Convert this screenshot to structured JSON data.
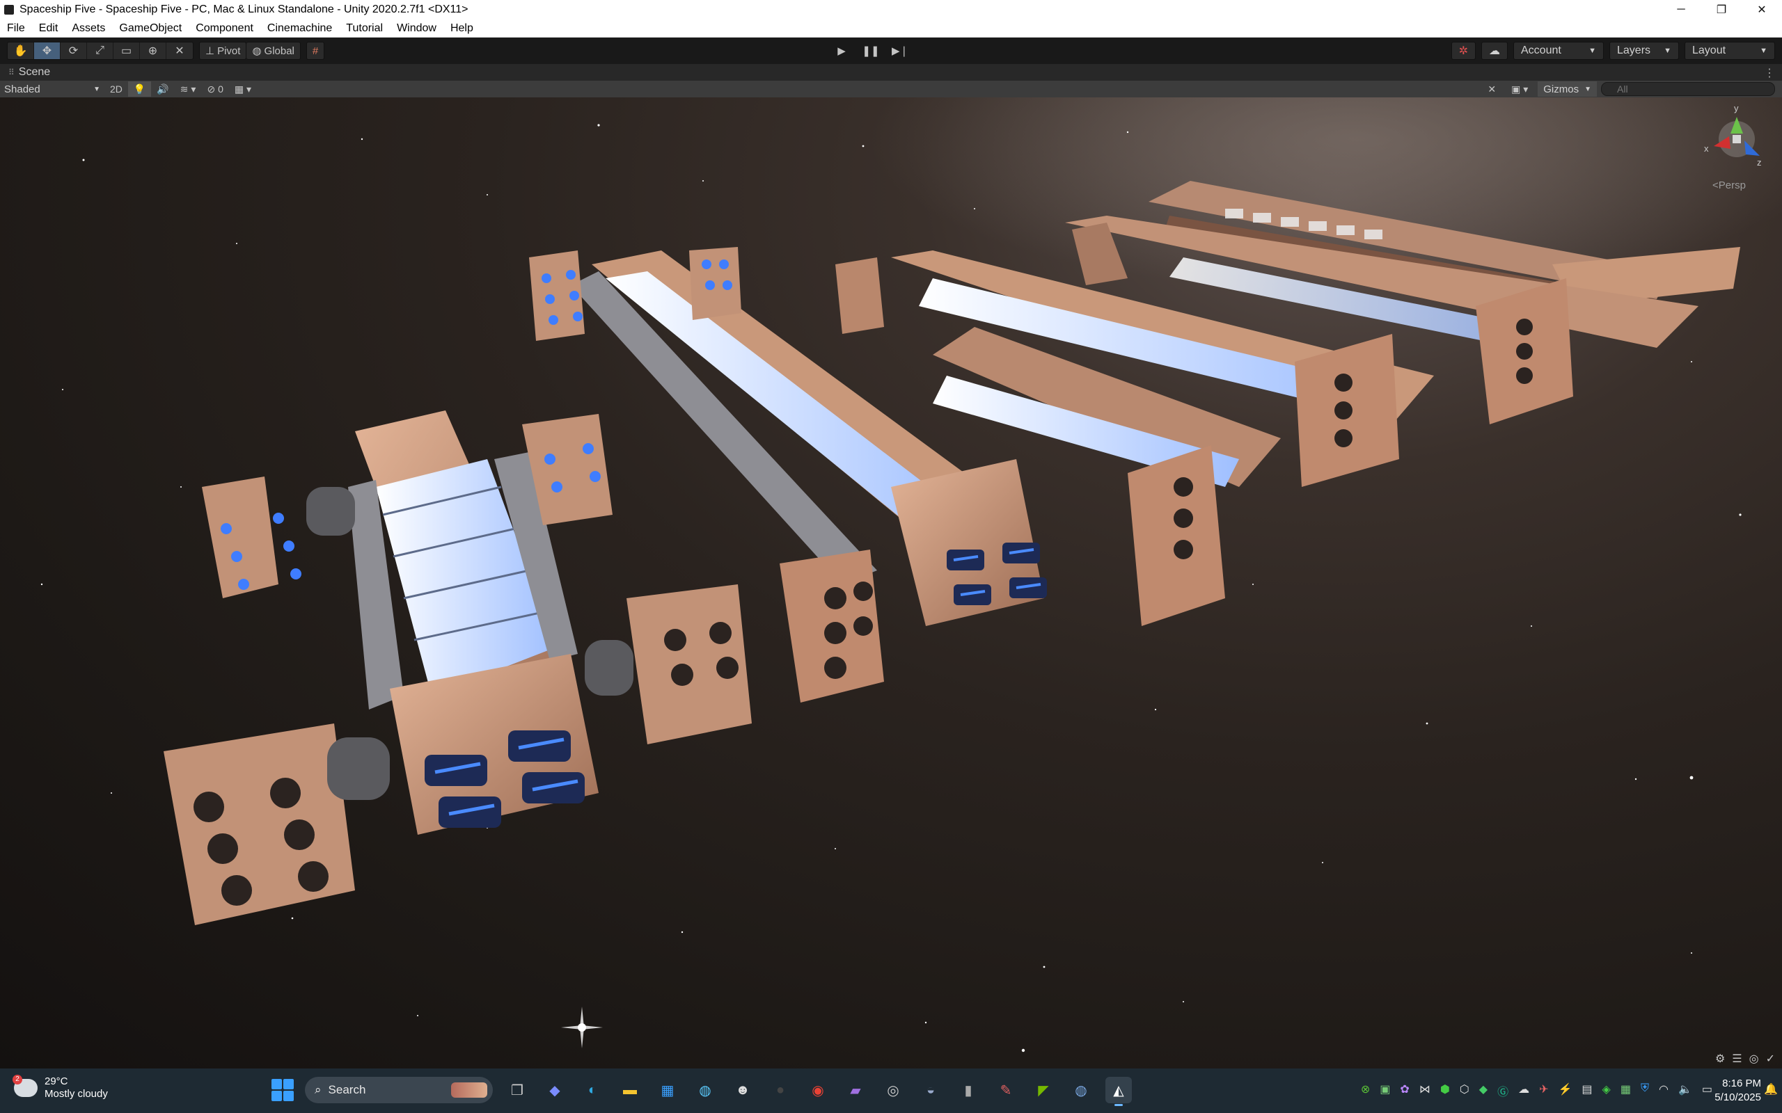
{
  "window": {
    "title": "Spaceship Five - Spaceship Five - PC, Mac & Linux Standalone - Unity 2020.2.7f1 <DX11>",
    "minimize": "─",
    "maximize": "❐",
    "close": "✕"
  },
  "menu": [
    "File",
    "Edit",
    "Assets",
    "GameObject",
    "Component",
    "Cinemachine",
    "Tutorial",
    "Window",
    "Help"
  ],
  "toolbar": {
    "pivot_label": "Pivot",
    "global_label": "Global",
    "account_label": "Account",
    "layers_label": "Layers",
    "layout_label": "Layout"
  },
  "scene": {
    "tab_label": "Scene",
    "shading_mode": "Shaded",
    "mode_2d": "2D",
    "hidden_count": "0",
    "gizmos_label": "Gizmos",
    "search_placeholder": "All",
    "persp_label": "<Persp",
    "axis_x": "x",
    "axis_y": "y",
    "axis_z": "z",
    "colors": {
      "x_axis": "#d23030",
      "y_axis": "#6cc24a",
      "z_axis": "#2f6bd8",
      "hull": "#c9987a",
      "glow": "#3f7dff"
    }
  },
  "taskbar": {
    "temperature": "29°C",
    "condition": "Mostly cloudy",
    "weather_badge": "2",
    "search_label": "Search",
    "time": "8:16 PM",
    "date": "5/10/2025"
  }
}
